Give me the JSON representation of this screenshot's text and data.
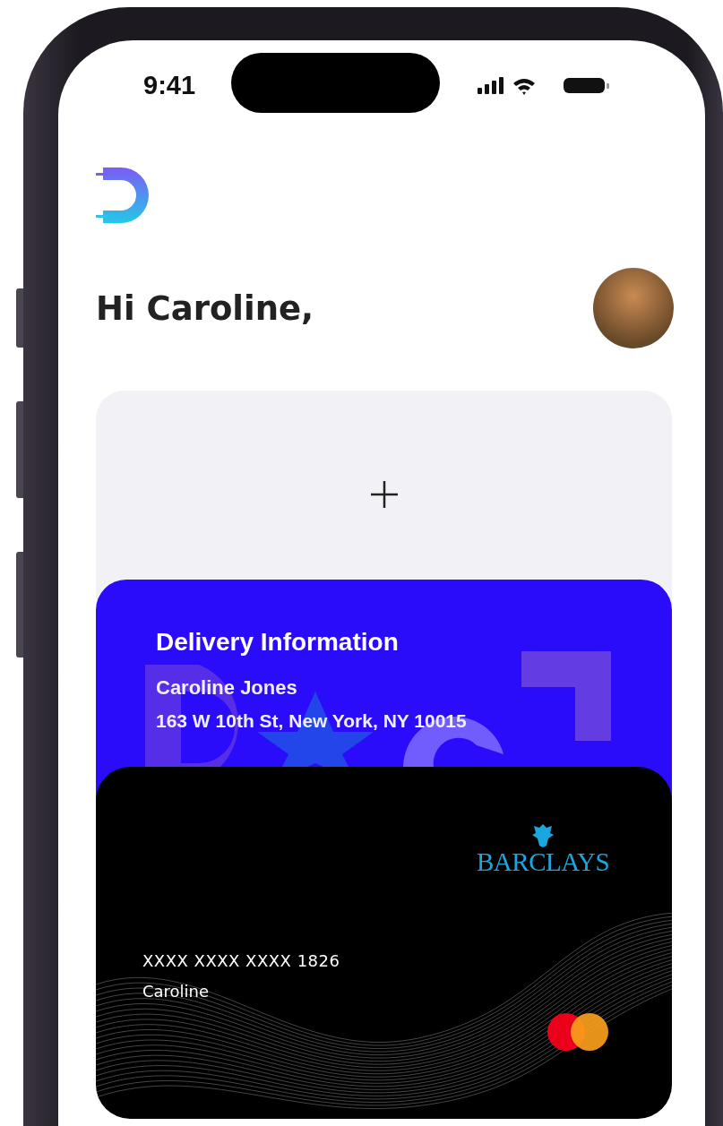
{
  "status_bar": {
    "time": "9:41"
  },
  "greeting": "Hi Caroline,",
  "delivery_card": {
    "title": "Delivery Information",
    "name": "Caroline Jones",
    "address": "163 W 10th St, New York, NY 10015"
  },
  "payment_card": {
    "bank": "BARCLAYS",
    "number": "XXXX XXXX XXXX 1826",
    "holder": "Caroline"
  }
}
